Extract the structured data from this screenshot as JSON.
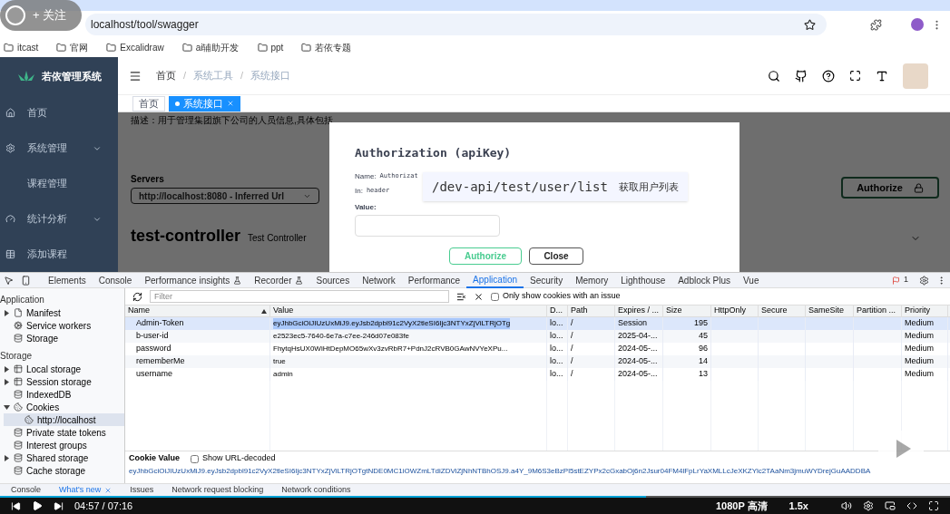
{
  "video_overlay": {
    "follow_button": "+ 关注"
  },
  "browser": {
    "url": "localhost/tool/swagger",
    "bookmarks": [
      "itcast",
      "官网",
      "Excalidraw",
      "ai辅助开发",
      "ppt",
      "若依专题"
    ]
  },
  "app": {
    "logo": "若依管理系统",
    "sidebar": [
      {
        "label": "首页",
        "expandable": false
      },
      {
        "label": "系统管理",
        "expandable": true
      },
      {
        "label": "课程管理",
        "expandable": false
      },
      {
        "label": "统计分析",
        "expandable": true
      },
      {
        "label": "添加课程",
        "expandable": false
      }
    ],
    "breadcrumb": [
      "首页",
      "系统工具",
      "系统接口"
    ],
    "breadcrumb_separator": "/",
    "tags": [
      {
        "label": "首页",
        "selected": false
      },
      {
        "label": "系统接口",
        "selected": true
      }
    ]
  },
  "swagger": {
    "description": "描述：用于管理集团旗下公司的人员信息,具体包括",
    "servers_label": "Servers",
    "server": "http://localhost:8080 - Inferred Url",
    "authorize": "Authorize",
    "controller": "test-controller",
    "controller_desc": "Test Controller"
  },
  "modal": {
    "title": "Authorization (apiKey)",
    "name_label": "Name:",
    "name_value": "Authorizat",
    "in_label": "In:",
    "in_value": "header",
    "value_label": "Value:",
    "authorize": "Authorize",
    "close": "Close"
  },
  "tooltip": {
    "path": "/dev-api/test/user/list",
    "text": "获取用户列表"
  },
  "devtools": {
    "tabs": [
      {
        "label": "Elements",
        "selected": false,
        "experimental": false
      },
      {
        "label": "Console",
        "selected": false,
        "experimental": false
      },
      {
        "label": "Performance insights",
        "selected": false,
        "experimental": true
      },
      {
        "label": "Recorder",
        "selected": false,
        "experimental": true
      },
      {
        "label": "Sources",
        "selected": false,
        "experimental": false
      },
      {
        "label": "Network",
        "selected": false,
        "experimental": false
      },
      {
        "label": "Performance",
        "selected": false,
        "experimental": false
      },
      {
        "label": "Application",
        "selected": true,
        "experimental": false
      },
      {
        "label": "Security",
        "selected": false,
        "experimental": false
      },
      {
        "label": "Memory",
        "selected": false,
        "experimental": false
      },
      {
        "label": "Lighthouse",
        "selected": false,
        "experimental": false
      },
      {
        "label": "Adblock Plus",
        "selected": false,
        "experimental": false
      },
      {
        "label": "Vue",
        "selected": false,
        "experimental": false
      }
    ],
    "issues_count": "1",
    "tree": [
      {
        "kind": "heading",
        "label": "Application"
      },
      {
        "kind": "item",
        "label": "Manifest",
        "expanded": false,
        "selected": false
      },
      {
        "kind": "item",
        "label": "Service workers",
        "selected": false
      },
      {
        "kind": "item",
        "label": "Storage",
        "selected": false
      },
      {
        "kind": "heading",
        "label": "Storage"
      },
      {
        "kind": "item",
        "label": "Local storage",
        "expanded": false,
        "selected": false
      },
      {
        "kind": "item",
        "label": "Session storage",
        "expanded": false,
        "selected": false
      },
      {
        "kind": "item",
        "label": "IndexedDB",
        "selected": false
      },
      {
        "kind": "item",
        "label": "Cookies",
        "expanded": true,
        "selected": false,
        "children": [
          {
            "kind": "item",
            "label": "http://localhost",
            "selected": true
          }
        ]
      },
      {
        "kind": "item",
        "label": "Private state tokens",
        "selected": false
      },
      {
        "kind": "item",
        "label": "Interest groups",
        "selected": false
      },
      {
        "kind": "item",
        "label": "Shared storage",
        "expanded": false,
        "selected": false
      },
      {
        "kind": "item",
        "label": "Cache storage",
        "selected": false
      }
    ],
    "filter_placeholder": "Filter",
    "only_issue": {
      "label": "Only show cookies with an issue",
      "checked": false
    },
    "columns": [
      "Name",
      "Value",
      "D...",
      "Path",
      "Expires / ...",
      "Size",
      "HttpOnly",
      "Secure",
      "SameSite",
      "Partition ...",
      "Priority"
    ],
    "rows": [
      {
        "selected": true,
        "cells": [
          "Admin-Token",
          "eyJhbGciOiJIUzUxMiJ9.eyJsb2dpbl91c2VyX2tleSI6Ijc3NTYxZjViLTRjOTg",
          "lo...",
          "/",
          "Session",
          "195",
          "",
          "",
          "",
          "",
          "Medium"
        ]
      },
      {
        "selected": false,
        "cells": [
          "b-user-id",
          "e2523ec5-7640-6e7a-c7ee-246d07e083fe",
          "lo...",
          "/",
          "2025-04-...",
          "45",
          "",
          "",
          "",
          "",
          "Medium"
        ]
      },
      {
        "selected": false,
        "cells": [
          "password",
          "FhytqHsUX0WiHtDepMO65wXv3zvRbR7+PdnJ2cRVB0GAwNVYeXPu...",
          "lo...",
          "/",
          "2024-05-...",
          "96",
          "",
          "",
          "",
          "",
          "Medium"
        ]
      },
      {
        "selected": false,
        "cells": [
          "rememberMe",
          "true",
          "lo...",
          "/",
          "2024-05-...",
          "14",
          "",
          "",
          "",
          "",
          "Medium"
        ]
      },
      {
        "selected": false,
        "cells": [
          "username",
          "admin",
          "lo...",
          "/",
          "2024-05-...",
          "13",
          "",
          "",
          "",
          "",
          "Medium"
        ]
      }
    ],
    "cookie_value": {
      "label": "Cookie Value",
      "url_decoded": {
        "label": "Show URL-decoded",
        "checked": false
      },
      "value": "eyJhbGciOiJIUzUxMiJ9.eyJsb2dpbl91c2VyX2tleSI6Ijc3NTYxZjViLTRjOTgtNDE0MC1iOWZmLTdiZDViZjNhNTBhOSJ9.a4Y_9M6S3eBzPl5stEZYPx2cGxabOj6n2Jsur04FM4lFpLrYaXMLLcJeXKZYlc2TAaNm3jmuWYDrejGuAADDBA"
    },
    "drawer_tabs": [
      {
        "label": "Console",
        "selected": false,
        "closable": false
      },
      {
        "label": "What's new",
        "selected": true,
        "closable": true
      },
      {
        "label": "Issues",
        "selected": false,
        "closable": false
      },
      {
        "label": "Network request blocking",
        "selected": false,
        "closable": false
      },
      {
        "label": "Network conditions",
        "selected": false,
        "closable": false
      }
    ]
  },
  "player": {
    "time": "04:57 / 07:16",
    "quality": "1080P 高清",
    "speed": "1.5x",
    "level": 0.68
  }
}
